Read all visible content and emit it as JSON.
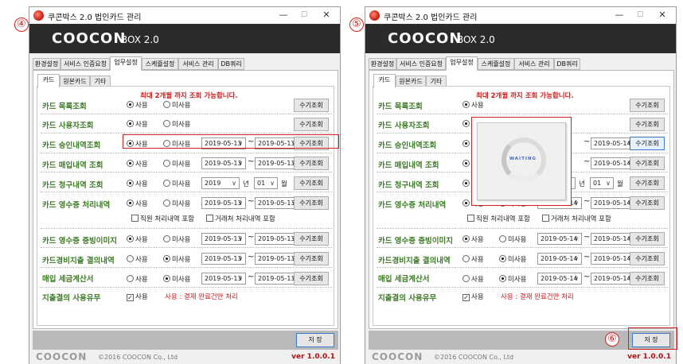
{
  "steps": {
    "left": "④",
    "right": "⑤",
    "save": "⑥"
  },
  "window": {
    "title": "쿠콘박스 2.0 법인카드 관리",
    "min_glyph": "—",
    "max_glyph": "☐",
    "close_glyph": "✕"
  },
  "logo": {
    "brand": "COOCON",
    "product": "BOX 2.0"
  },
  "top_tabs": [
    "환경설정",
    "서비스 인증요청",
    "업무설정",
    "스케쥴설정",
    "서비스 관리",
    "DB쿼리"
  ],
  "active_top_tab": "업무설정",
  "sub_tabs": [
    "카드",
    "원본카드",
    "기타"
  ],
  "notice": "최대 2개월 까지 조회 가능합니다.",
  "labels": {
    "use": "사용",
    "not_use": "미사용",
    "tilde": "~",
    "year_unit": "년",
    "month_unit": "월",
    "manual_query": "수기조회"
  },
  "rows": [
    {
      "label": "카드 목록조회",
      "selected": "use"
    },
    {
      "label": "카드 사용자조회",
      "selected": "use"
    },
    {
      "label": "카드 승인내역조회",
      "selected": "use",
      "from": "2019-05-13",
      "to": "2019-05-13",
      "from_right": "2019-05-14",
      "to_right": "2019-05-14"
    },
    {
      "label": "카드 매입내역 조회",
      "selected": "use",
      "from": "2019-05-13",
      "to": "2019-05-13",
      "from_right": "2019-05-14",
      "to_right": "2019-05-14"
    },
    {
      "label": "카드 청구내역 조회",
      "selected": "use",
      "year": "2019",
      "month": "01"
    },
    {
      "label": "카드 영수증 처리내역",
      "selected": "use",
      "from": "2019-05-13",
      "to": "2019-05-13",
      "from_right": "2019-05-14",
      "to_right": "2019-05-14"
    },
    {
      "label": "카드 영수증 증빙이미지",
      "selected": "use",
      "from": "2019-05-13",
      "to": "2019-05-13",
      "from_right": "2019-05-14",
      "to_right": "2019-05-14"
    },
    {
      "label": "카드경비지출 결의내역",
      "selected": "not_use",
      "from": "2019-05-13",
      "to": "2019-05-13",
      "from_right": "2019-05-14",
      "to_right": "2019-05-14"
    },
    {
      "label": "매입 세금계산서",
      "selected": "not_use",
      "from": "2019-05-13",
      "to": "2019-05-13",
      "from_right": "2019-05-14",
      "to_right": "2019-05-14"
    },
    {
      "label": "지출결의 사용유무"
    }
  ],
  "receipt_checks": {
    "employee": "직원 처리내역 포함",
    "vendor": "거래처 처리내역 포함"
  },
  "expense_use_note": "사용 : 결재 완료건만 처리",
  "save_label": "저 장",
  "footer": {
    "logo": "COOCON",
    "copyright": "©2016 COOCON Co., Ltd",
    "version": "ver 1.0.0.1"
  },
  "loading_text": "WAITING",
  "colors": {
    "label_green": "#3d7a26",
    "notice_red": "#d01818",
    "logo_bar": "#2b2b2b",
    "highlight": "#d02020"
  }
}
